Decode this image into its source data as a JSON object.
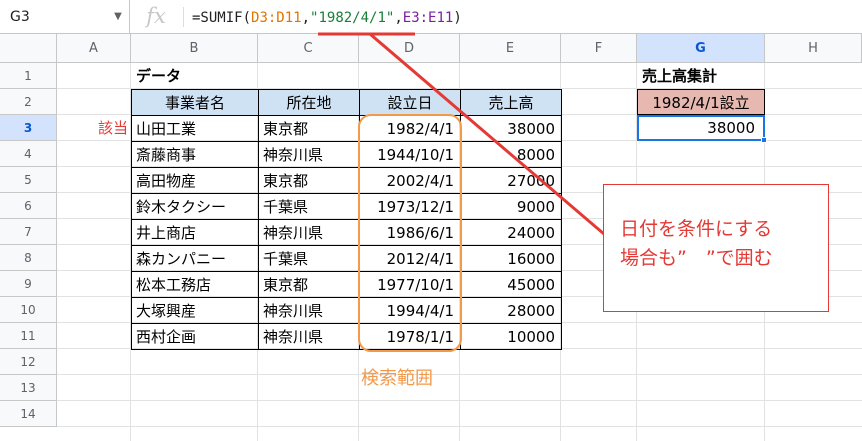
{
  "name_box": "G3",
  "fx_label": "fx",
  "formula": {
    "prefix": "=SUMIF(",
    "range1": "D3:D11",
    "comma1": ",",
    "criteria": "\"1982/4/1\"",
    "comma2": ",",
    "range2": "E3:E11",
    "suffix": ")"
  },
  "columns": [
    "A",
    "B",
    "C",
    "D",
    "E",
    "F",
    "G",
    "H"
  ],
  "rows": [
    "1",
    "2",
    "3",
    "4",
    "5",
    "6",
    "7",
    "8",
    "9",
    "10",
    "11",
    "12",
    "13",
    "14"
  ],
  "table": {
    "title": "データ",
    "headers": [
      "事業者名",
      "所在地",
      "設立日",
      "売上高"
    ],
    "data": [
      [
        "山田工業",
        "東京都",
        "1982/4/1",
        "38000"
      ],
      [
        "斎藤商事",
        "神奈川県",
        "1944/10/1",
        "8000"
      ],
      [
        "高田物産",
        "東京都",
        "2002/4/1",
        "27000"
      ],
      [
        "鈴木タクシー",
        "千葉県",
        "1973/12/1",
        "9000"
      ],
      [
        "井上商店",
        "神奈川県",
        "1986/6/1",
        "24000"
      ],
      [
        "森カンパニー",
        "千葉県",
        "2012/4/1",
        "16000"
      ],
      [
        "松本工務店",
        "東京都",
        "1977/10/1",
        "45000"
      ],
      [
        "大塚興産",
        "神奈川県",
        "1994/4/1",
        "28000"
      ],
      [
        "西村企画",
        "神奈川県",
        "1978/1/1",
        "10000"
      ]
    ],
    "header_color": "#cfe2f3"
  },
  "match_label": "該当",
  "summary": {
    "title": "売上高集計",
    "header": "1982/4/1設立",
    "header_color": "#e6b8af",
    "value": "38000"
  },
  "annotations": {
    "range_label": "検索範囲",
    "callout_line1": "日付を条件にする",
    "callout_line2": "場合も”　”で囲む",
    "orange": "#f2994a",
    "red": "#e53935"
  }
}
